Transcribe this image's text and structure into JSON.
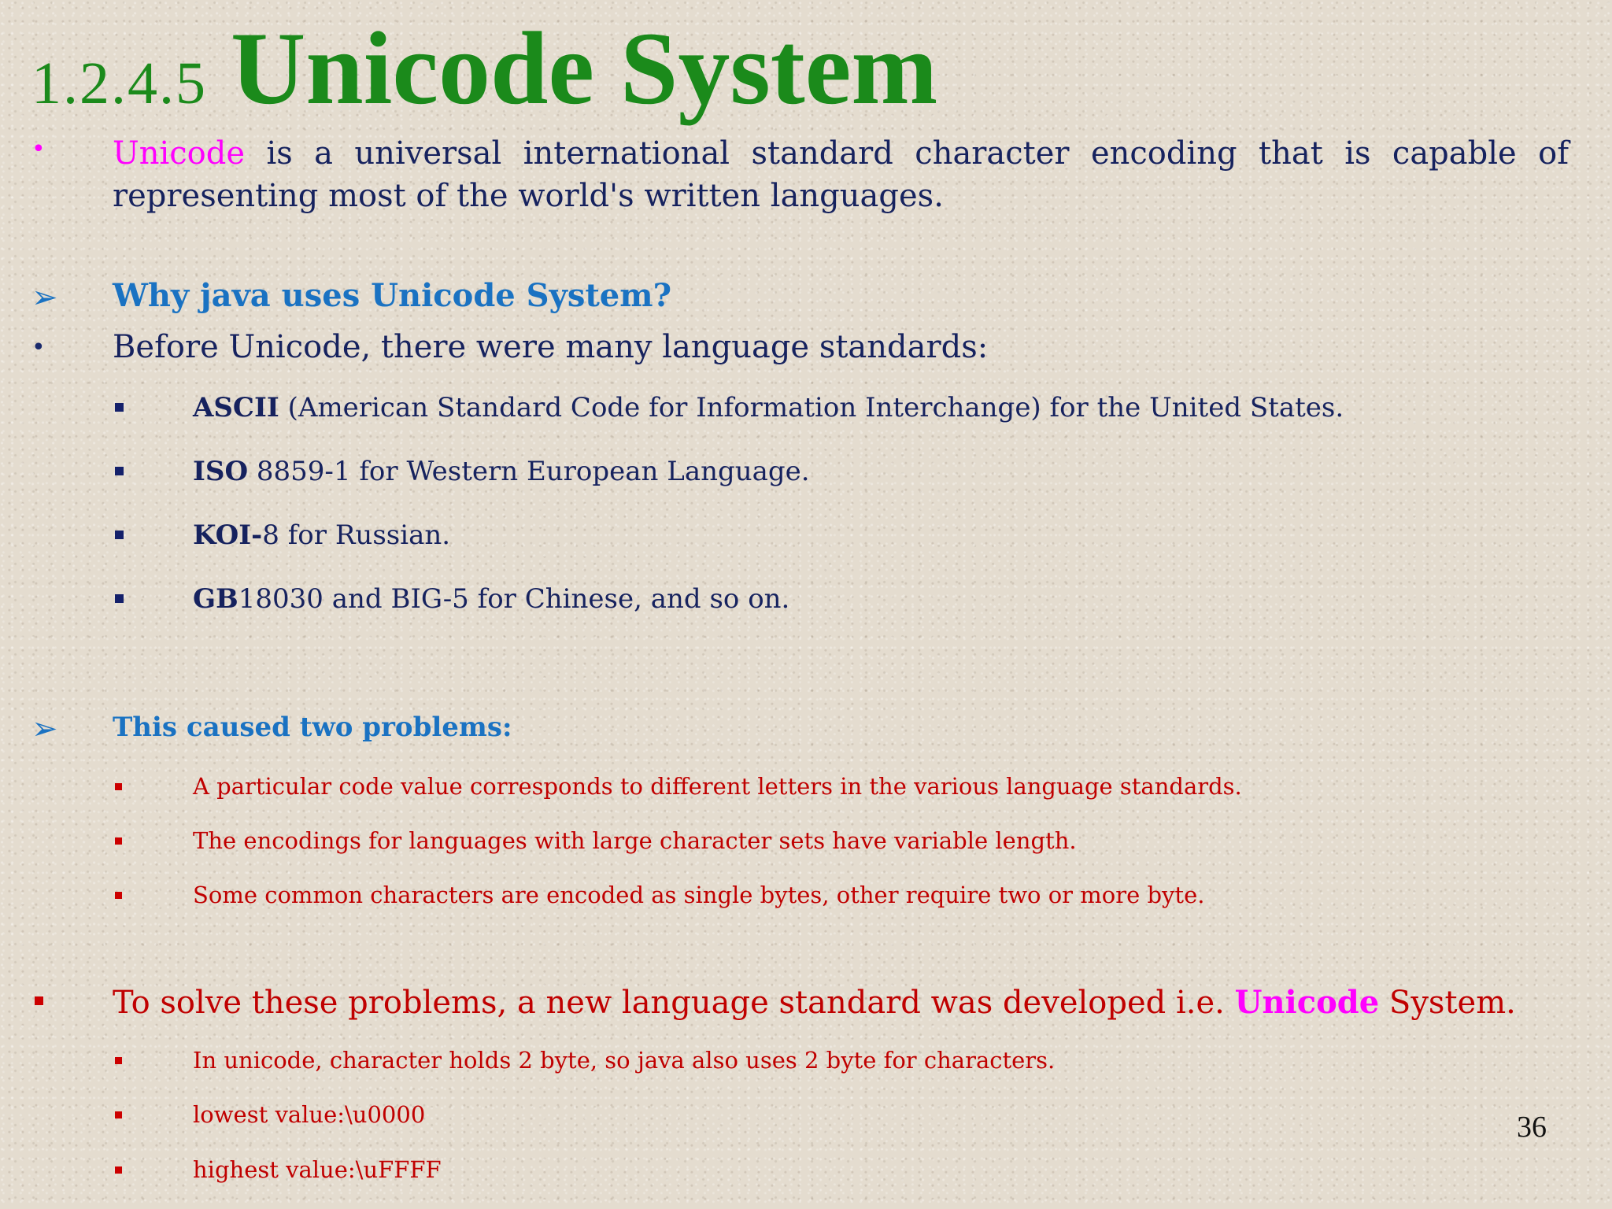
{
  "title": {
    "number": "1.2.4.5",
    "text": "Unicode System"
  },
  "intro": {
    "highlight": "Unicode",
    "text": " is a universal international standard character encoding that is capable of representing most of the world's written languages."
  },
  "why_heading": "Why java uses Unicode System?",
  "before_text": "Before Unicode, there were many language standards:",
  "standards": [
    {
      "bold": "ASCII",
      "rest": " (American Standard Code for Information Interchange) for the United States."
    },
    {
      "bold": "ISO",
      "rest": " 8859-1 for Western European Language."
    },
    {
      "bold": "KOI-",
      "rest": "8 for Russian."
    },
    {
      "bold": "GB",
      "rest": "18030 and BIG-5 for Chinese, and so on."
    }
  ],
  "problems_heading": "This caused two problems:",
  "problems": [
    "A particular code value corresponds to different letters in the various language standards.",
    "The encodings for languages with large character sets have variable length.",
    "Some common characters are encoded as single bytes, other require two or more byte."
  ],
  "solution": {
    "before": "To solve these problems, a new language standard was developed i.e. ",
    "highlight": "Unicode",
    "after": " System."
  },
  "details": [
    "In unicode, character holds 2 byte, so java also uses 2 byte for characters.",
    "lowest value:\\u0000",
    "highest value:\\uFFFF"
  ],
  "page_number": "36",
  "colors": {
    "title": "#1b8a1b",
    "navy": "#16225e",
    "blue_heading": "#1a72c2",
    "red": "#c00000",
    "magenta": "#ff00ff"
  }
}
